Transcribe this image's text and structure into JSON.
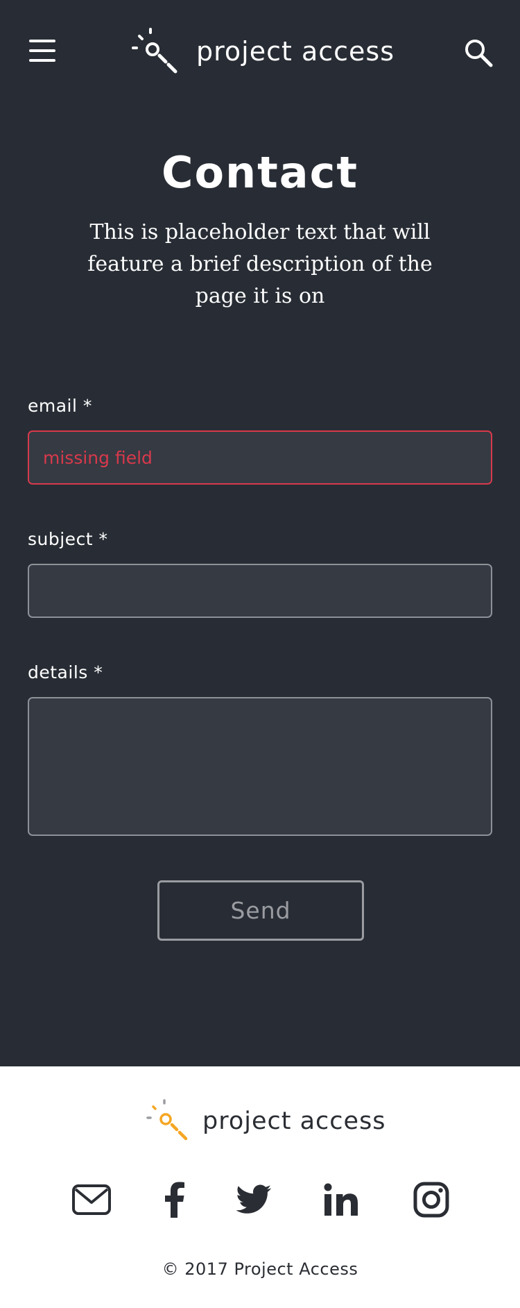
{
  "header": {
    "logo_text": "project access"
  },
  "hero": {
    "title": "Contact",
    "description": "This is placeholder text that will feature a brief description of the page it is on"
  },
  "form": {
    "email": {
      "label": "email *",
      "placeholder": "missing field",
      "value": "",
      "state": "error"
    },
    "subject": {
      "label": "subject *",
      "value": ""
    },
    "details": {
      "label": "details *",
      "value": ""
    },
    "send_label": "Send"
  },
  "footer": {
    "logo_text": "project access",
    "social_icons": [
      "mail-icon",
      "facebook-icon",
      "twitter-icon",
      "linkedin-icon",
      "instagram-icon"
    ],
    "copyright": "© 2017 Project Access"
  },
  "colors": {
    "background": "#282d35",
    "field_background": "#353a43",
    "error": "#d8394b",
    "accent": "#f5a623",
    "footer_text": "#2a2d33"
  }
}
